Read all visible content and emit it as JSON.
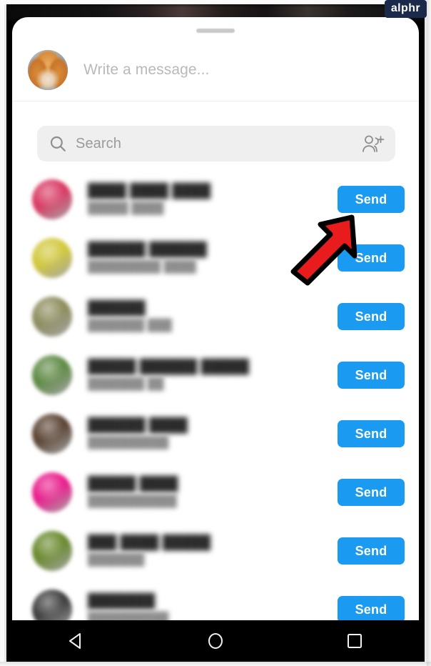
{
  "watermark": {
    "label": "alphr"
  },
  "sheet": {
    "drag_handle": "drag-handle",
    "composer": {
      "avatar_alt": "dog-profile-photo",
      "placeholder": "Write a message..."
    },
    "search": {
      "placeholder": "Search",
      "search_icon": "search-icon",
      "add_people_icon": "add-people-icon"
    },
    "contacts": {
      "send_label": "Send",
      "rows": [
        {
          "name": "████ ████ ████",
          "handle": "█████ ████",
          "avatar_color": "#d93a63",
          "send_label": "Send"
        },
        {
          "name": "██████ ██████",
          "handle": "█████████ ████",
          "avatar_color": "#d2c83c",
          "send_label": "Send"
        },
        {
          "name": "██████",
          "handle": "███████ ███",
          "avatar_color": "#8d8d5e",
          "send_label": "Send"
        },
        {
          "name": "█████ ██████ █████",
          "handle": "███████ ██",
          "avatar_color": "#5f8a45",
          "send_label": "Send"
        },
        {
          "name": "██████ ████",
          "handle": "██████████",
          "avatar_color": "#5b4434",
          "send_label": "Send"
        },
        {
          "name": "█████ ████",
          "handle": "███████████",
          "avatar_color": "#e91e8c",
          "send_label": "Send"
        },
        {
          "name": "███ ████ █████",
          "handle": "███████",
          "avatar_color": "#6a8a2e",
          "send_label": "Send"
        },
        {
          "name": "███████",
          "handle": "██████████",
          "avatar_color": "#3f3f3f",
          "send_label": "Send"
        }
      ]
    }
  },
  "annotation": {
    "arrow_color": "#e81c1c",
    "arrow_outline": "#000000",
    "arrow_direction": "up-right"
  },
  "navbar": {
    "back_icon": "back-triangle-icon",
    "home_icon": "home-circle-icon",
    "recents_icon": "recents-square-icon"
  },
  "theme": {
    "send_button_color": "#1a9af0",
    "search_bg": "#efefef",
    "sheet_bg": "#ffffff",
    "navbar_bg": "#000000",
    "watermark_bg": "#1b2a4a"
  }
}
